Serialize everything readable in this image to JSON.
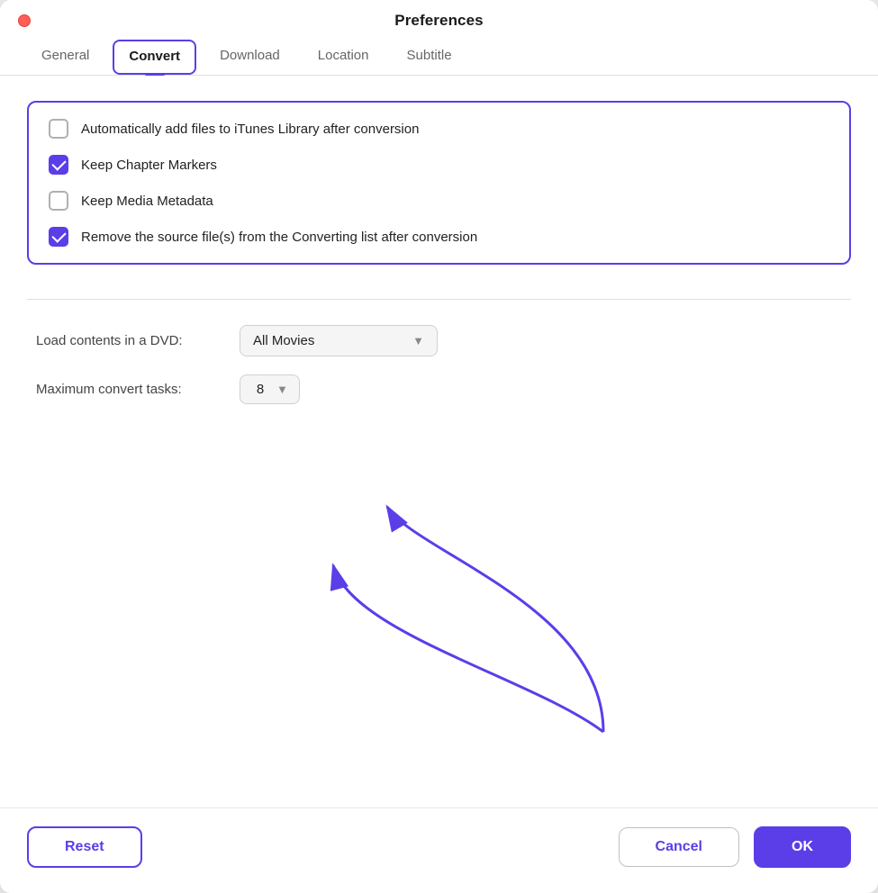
{
  "window": {
    "title": "Preferences",
    "trafficLight": "close"
  },
  "tabs": [
    {
      "id": "general",
      "label": "General",
      "active": false
    },
    {
      "id": "convert",
      "label": "Convert",
      "active": true
    },
    {
      "id": "download",
      "label": "Download",
      "active": false
    },
    {
      "id": "location",
      "label": "Location",
      "active": false
    },
    {
      "id": "subtitle",
      "label": "Subtitle",
      "active": false
    }
  ],
  "options": [
    {
      "id": "itunes",
      "label": "Automatically add files to iTunes Library after conversion",
      "checked": false
    },
    {
      "id": "chapter",
      "label": "Keep Chapter Markers",
      "checked": true
    },
    {
      "id": "metadata",
      "label": "Keep Media Metadata",
      "checked": false
    },
    {
      "id": "remove",
      "label": "Remove the source file(s) from the Converting list after conversion",
      "checked": true
    }
  ],
  "settings": {
    "dvdLabel": "Load contents in a DVD:",
    "dvdValue": "All Movies",
    "tasksLabel": "Maximum convert tasks:",
    "tasksValue": "8"
  },
  "footer": {
    "resetLabel": "Reset",
    "cancelLabel": "Cancel",
    "okLabel": "OK"
  }
}
